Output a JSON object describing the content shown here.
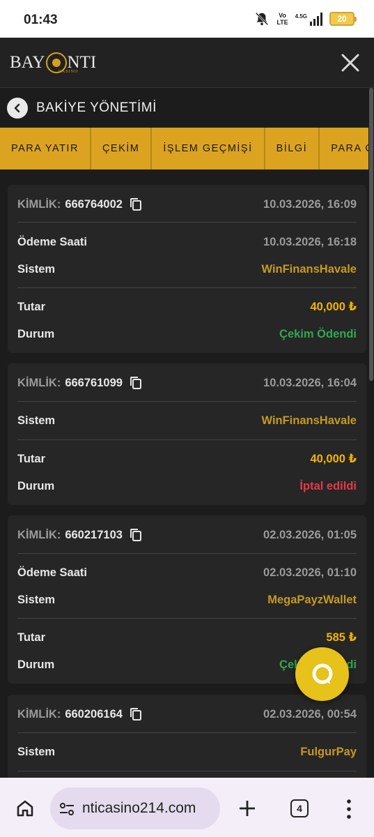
{
  "status_bar": {
    "time": "01:43",
    "network": "Vo\nLTE",
    "net_speed": "4.5G",
    "battery": "20"
  },
  "header": {
    "logo_text_left": "BAY",
    "logo_text_right": "NTI",
    "logo_sub": "CASINO",
    "close_icon": "close-icon"
  },
  "page": {
    "title": "BAKİYE YÖNETİMİ"
  },
  "tabs": [
    {
      "label": "PARA YATIR"
    },
    {
      "label": "ÇEKİM"
    },
    {
      "label": "İŞLEM GEÇMİŞİ"
    },
    {
      "label": "BİLGİ"
    },
    {
      "label": "PARA ÇEKİM"
    }
  ],
  "labels": {
    "id": "KİMLİK:",
    "payment_time": "Ödeme Saati",
    "system": "Sistem",
    "amount": "Tutar",
    "status": "Durum"
  },
  "transactions": [
    {
      "id": "666764002",
      "date": "10.03.2026, 16:09",
      "payment_time": "10.03.2026, 16:18",
      "system": "WinFinansHavale",
      "amount": "40,000 ₺",
      "status": "Çekim Ödendi",
      "status_type": "paid"
    },
    {
      "id": "666761099",
      "date": "10.03.2026, 16:04",
      "system": "WinFinansHavale",
      "amount": "40,000 ₺",
      "status": "İptal edildi",
      "status_type": "cancelled"
    },
    {
      "id": "660217103",
      "date": "02.03.2026, 01:05",
      "payment_time": "02.03.2026, 01:10",
      "system": "MegaPayzWallet",
      "amount": "585 ₺",
      "status": "Çekim Ödendi",
      "status_type": "paid"
    },
    {
      "id": "660206164",
      "date": "02.03.2026, 00:54",
      "system": "FulgurPay"
    }
  ],
  "browser": {
    "url": "nticasino214.com",
    "tab_count": "4"
  },
  "colors": {
    "accent": "#dba320",
    "amount": "#f2b400",
    "system": "#c79a20",
    "paid": "#2fa84f",
    "cancelled": "#e33a4a"
  }
}
